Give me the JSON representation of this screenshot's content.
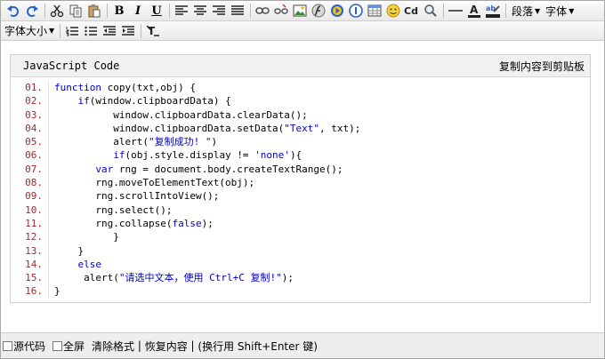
{
  "toolbar1": {
    "paragraph_label": "段落",
    "font_label": "字体"
  },
  "toolbar2": {
    "fontsize_label": "字体大小"
  },
  "codeblock": {
    "language": "JavaScript Code",
    "copy_label": "复制内容到剪贴板",
    "lines": [
      {
        "no": "01.",
        "text": "function copy(txt,obj) {"
      },
      {
        "no": "02.",
        "text": "    if(window.clipboardData) {"
      },
      {
        "no": "03.",
        "text": "          window.clipboardData.clearData();"
      },
      {
        "no": "04.",
        "text": "          window.clipboardData.setData(\"Text\", txt);"
      },
      {
        "no": "05.",
        "text": "          alert(\"复制成功! \")"
      },
      {
        "no": "06.",
        "text": "          if(obj.style.display != 'none'){"
      },
      {
        "no": "07.",
        "text": "       var rng = document.body.createTextRange();"
      },
      {
        "no": "08.",
        "text": "       rng.moveToElementText(obj);"
      },
      {
        "no": "09.",
        "text": "       rng.scrollIntoView();"
      },
      {
        "no": "10.",
        "text": "       rng.select();"
      },
      {
        "no": "11.",
        "text": "       rng.collapse(false);"
      },
      {
        "no": "12.",
        "text": "          }"
      },
      {
        "no": "13.",
        "text": "    }"
      },
      {
        "no": "14.",
        "text": "    else"
      },
      {
        "no": "15.",
        "text": "     alert(\"请选中文本，使用 Ctrl+C 复制!\");"
      },
      {
        "no": "16.",
        "text": "}"
      }
    ]
  },
  "bottombar": {
    "source_label": "源代码",
    "fullscreen_label": "全屏",
    "clear_format_label": "清除格式",
    "sep1": " | ",
    "restore_label": "恢复内容",
    "sep2": " | ",
    "hint": "(换行用 Shift+Enter 键)"
  },
  "colors": {
    "line_number": "#a52a2a",
    "keyword": "#0000cc"
  }
}
